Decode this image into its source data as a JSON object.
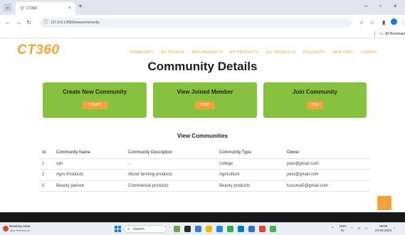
{
  "browser": {
    "tab_title": "CT360",
    "url": "127.0.0.1:8000/viewcommunity",
    "bookmarks_label": "All Bookmarks"
  },
  "site": {
    "logo": "CT360",
    "nav": [
      "COMMUNITY",
      "MY PROFILE",
      "ADD PRODUCTS",
      "MY PRODUCTS",
      "ALL PRODUCTS",
      "REQUESTS",
      "VIEW CART",
      "LOGOUT"
    ],
    "page_title": "Community Details",
    "cards": [
      {
        "title": "Create New Community",
        "button": "CREATE"
      },
      {
        "title": "View Joined Member",
        "button": "VIEW"
      },
      {
        "title": "Join Community",
        "button": "JOIN"
      }
    ],
    "section_title": "View Communities",
    "table": {
      "headers": [
        "Id",
        "Community Name",
        "Community Description",
        "Community Type",
        "Owner"
      ],
      "rows": [
        [
          "1",
          "vvit",
          "...",
          "college",
          "janu@gmail.com"
        ],
        [
          "2",
          "Agro Products",
          "About farming products",
          "Agriculture",
          "janu@gmail.com"
        ],
        [
          "3",
          "Beauty parlour",
          "Commercial products",
          "Beauty products",
          "kusuma5@gmail.com"
        ]
      ]
    }
  },
  "taskbar": {
    "news_title": "Breaking news",
    "news_sub": "Take Preview of...",
    "search_label": "Search",
    "lang": "ENG",
    "lang_region": "IN",
    "time": "09:05",
    "date": "23-03-2024"
  },
  "colors": {
    "accent": "#f0a630",
    "card": "#86c13f",
    "button": "#f4a13a"
  }
}
